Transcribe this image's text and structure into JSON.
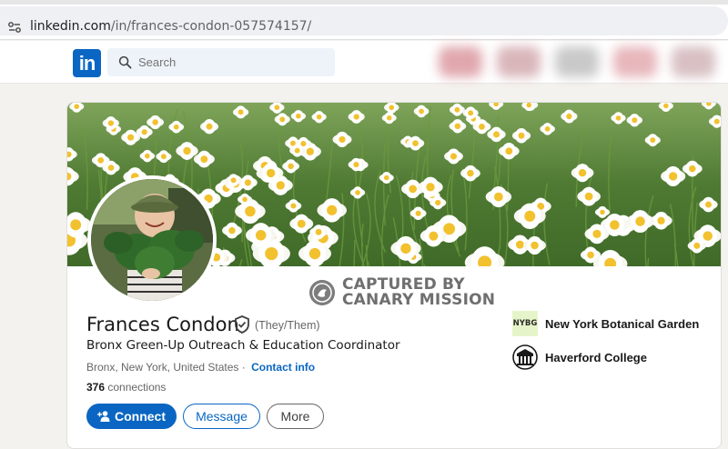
{
  "browser": {
    "url_host": "linkedin.com",
    "url_path": "/in/frances-condon-057574157/"
  },
  "nav": {
    "logo_text": "in",
    "search_placeholder": "Search",
    "brand_color": "#0a66c2"
  },
  "profile": {
    "name": "Frances Condon",
    "pronouns": "(They/Them)",
    "headline": "Bronx Green-Up Outreach & Education Coordinator",
    "location": "Bronx, New York, United States",
    "location_separator": "·",
    "contact_info_label": "Contact info",
    "connections_count": "376",
    "connections_label": "connections",
    "verified_icon": "shield-check-icon"
  },
  "watermark": {
    "line1": "CAPTURED BY",
    "line2": "CANARY MISSION"
  },
  "actions": {
    "connect_label": "Connect",
    "message_label": "Message",
    "more_label": "More"
  },
  "organizations": [
    {
      "logo_text": "NYBG",
      "name": "New York Botanical Garden"
    },
    {
      "logo_text": "",
      "name": "Haverford College"
    }
  ]
}
